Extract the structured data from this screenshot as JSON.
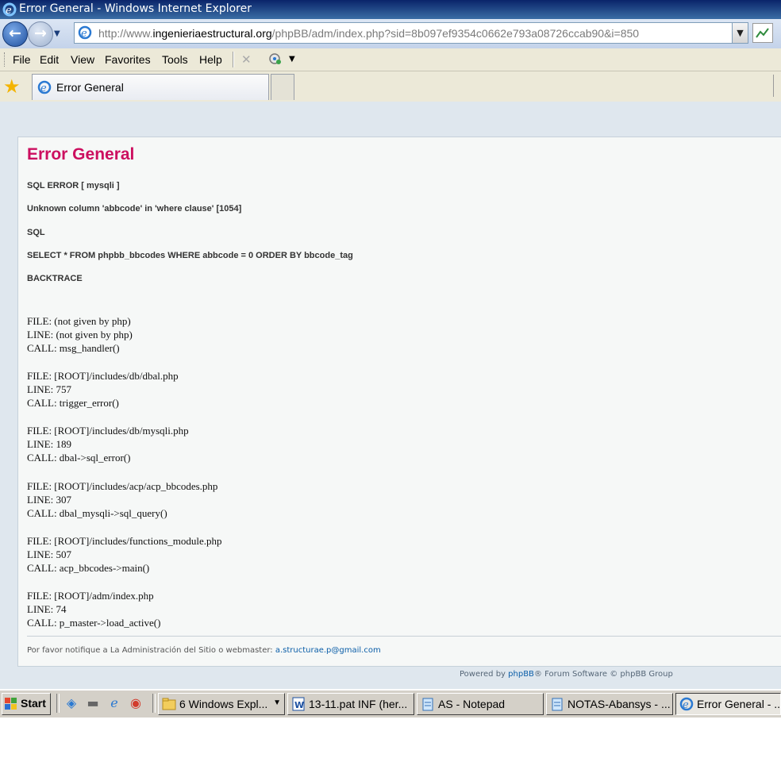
{
  "window": {
    "title": "Error General - Windows Internet Explorer"
  },
  "address": {
    "url_prefix": "http://www.",
    "url_host": "ingenieriaestructural.org",
    "url_path": "/phpBB/adm/index.php?sid=8b097ef9354c0662e793a08726ccab90&i=850"
  },
  "menu": [
    "File",
    "Edit",
    "View",
    "Favorites",
    "Tools",
    "Help"
  ],
  "tab": {
    "label": "Error General"
  },
  "page": {
    "title": "Error General",
    "sql_error": "SQL ERROR [ mysqli ]",
    "message": "Unknown column 'abbcode' in 'where clause' [1054]",
    "sql_label": "SQL",
    "sql": "SELECT * FROM phpbb_bbcodes WHERE abbcode = 0 ORDER BY bbcode_tag",
    "backtrace_label": "BACKTRACE",
    "backtrace": [
      [
        "FILE: (not given by php)",
        "LINE: (not given by php)",
        "CALL: msg_handler()"
      ],
      [
        "FILE: [ROOT]/includes/db/dbal.php",
        "LINE: 757",
        "CALL: trigger_error()"
      ],
      [
        "FILE: [ROOT]/includes/db/mysqli.php",
        "LINE: 189",
        "CALL: dbal->sql_error()"
      ],
      [
        "FILE: [ROOT]/includes/acp/acp_bbcodes.php",
        "LINE: 307",
        "CALL: dbal_mysqli->sql_query()"
      ],
      [
        "FILE: [ROOT]/includes/functions_module.php",
        "LINE: 507",
        "CALL: acp_bbcodes->main()"
      ],
      [
        "FILE: [ROOT]/adm/index.php",
        "LINE: 74",
        "CALL: p_master->load_active()"
      ]
    ],
    "notify_text": "Por favor notifique a La Administración del Sitio o webmaster:",
    "notify_email": "a.structurae.p@gmail.com",
    "powered_prefix": "Powered by",
    "powered_link": "phpBB",
    "powered_suffix": "® Forum Software © phpBB Group"
  },
  "taskbar": {
    "start": "Start",
    "tasks": [
      {
        "label": "6 Windows Expl...",
        "icon": "folder-icon"
      },
      {
        "label": "13-11.pat INF (her...",
        "icon": "word-icon"
      },
      {
        "label": "AS - Notepad",
        "icon": "notepad-icon"
      },
      {
        "label": "NOTAS-Abansys - ...",
        "icon": "notepad-icon"
      },
      {
        "label": "Error General - ...",
        "icon": "ie-icon"
      }
    ]
  },
  "colors": {
    "error_title": "#cc0f5f",
    "link": "#0b5ea8",
    "titlebar": "#0a246a"
  }
}
